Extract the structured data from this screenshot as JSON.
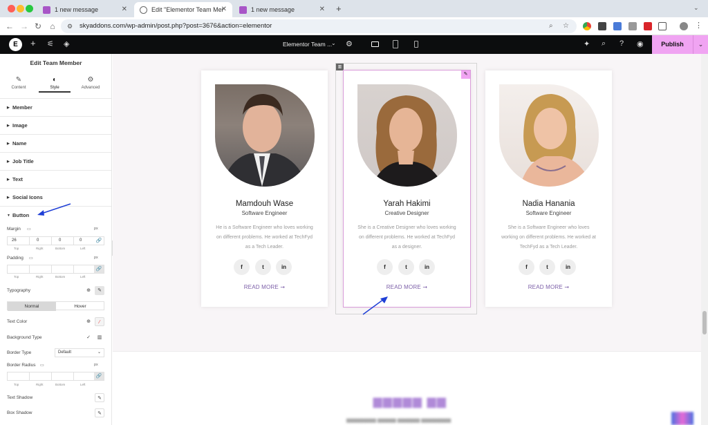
{
  "browser": {
    "tabs": [
      {
        "title": "1 new message",
        "active": false
      },
      {
        "title": "Edit \"Elementor Team Memb...",
        "active": true
      },
      {
        "title": "1 new message",
        "active": false
      }
    ],
    "new_tab": "+",
    "url": "skyaddons.com/wp-admin/post.php?post=3676&action=elementor"
  },
  "elementor": {
    "doc_title": "Elementor Team ...",
    "publish_label": "Publish"
  },
  "panel": {
    "title": "Edit Team Member",
    "tabs": [
      {
        "label": "Content",
        "icon": "pencil-icon"
      },
      {
        "label": "Style",
        "icon": "half-circle-icon"
      },
      {
        "label": "Advanced",
        "icon": "gear-icon"
      }
    ],
    "sections": [
      "Member",
      "Image",
      "Name",
      "Job Title",
      "Text",
      "Social Icons",
      "Button"
    ],
    "button": {
      "margin_label": "Margin",
      "margin_unit": "px",
      "margin_values": [
        "26",
        "0",
        "0",
        "0"
      ],
      "padding_label": "Padding",
      "padding_unit": "px",
      "dim_captions": [
        "Top",
        "Right",
        "Bottom",
        "Left"
      ],
      "typography_label": "Typography",
      "tabs": [
        "Normal",
        "Hover"
      ],
      "text_color_label": "Text Color",
      "bg_type_label": "Background Type",
      "border_type_label": "Border Type",
      "border_type_value": "Default",
      "border_radius_label": "Border Radius",
      "border_radius_unit": "px",
      "text_shadow_label": "Text Shadow",
      "box_shadow_label": "Box Shadow"
    }
  },
  "members": [
    {
      "name": "Mamdouh Wase",
      "job": "Software Engineer",
      "desc": "He is a Software Engineer who loves working on different problems. He worked at TechFyd as a Tech Leader.",
      "read_more": "READ MORE ➞"
    },
    {
      "name": "Yarah Hakimi",
      "job": "Creative Designer",
      "desc": "She is a Creative Designer who loves working on different problems. He worked at TechFyd as a designer.",
      "read_more": "READ MORE ➞"
    },
    {
      "name": "Nadia Hanania",
      "job": "Software Engineer",
      "desc": "She is a Software Engineer who loves working on different problems. He worked at TechFyd as a Tech Leader.",
      "read_more": "READ MORE ➞"
    }
  ],
  "social": [
    "f",
    "t",
    "in"
  ],
  "colors": {
    "accent_pink": "#f0a4f2",
    "read_more": "#7b5ea7",
    "annotation_arrow": "#1f3fd6"
  }
}
